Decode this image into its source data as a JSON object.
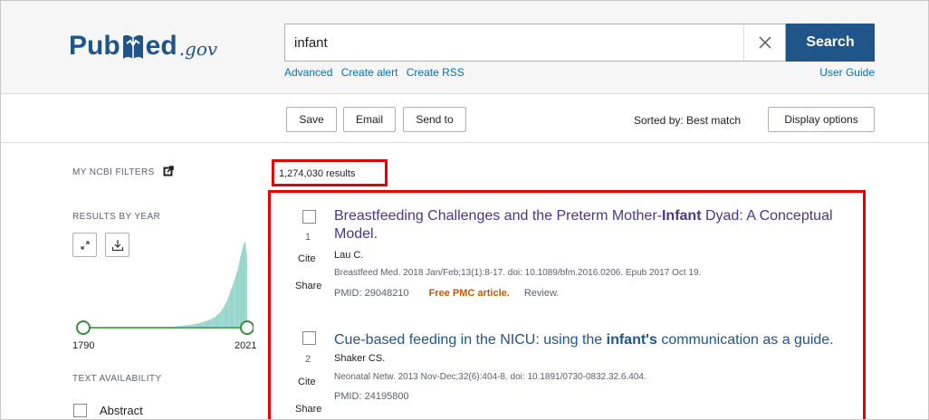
{
  "header": {
    "logo_pub": "Pub",
    "logo_med": "ed",
    "logo_gov": ".gov",
    "search_value": "infant",
    "search_button": "Search",
    "links": [
      "Advanced",
      "Create alert",
      "Create RSS"
    ],
    "user_guide": "User Guide"
  },
  "toolbar": {
    "save": "Save",
    "email": "Email",
    "send_to": "Send to",
    "sorted_by": "Sorted by: Best match",
    "display_options": "Display options"
  },
  "sidebar": {
    "my_ncbi_filters": "MY NCBI FILTERS",
    "results_by_year": "RESULTS BY YEAR",
    "year_start": "1790",
    "year_end": "2021",
    "text_availability": "TEXT AVAILABILITY",
    "abstract_label": "Abstract",
    "histogram_color": "#9fd9d1",
    "slider_color": "#3a8a3a"
  },
  "results": {
    "count": "1,274,030 results",
    "items": [
      {
        "num": "1",
        "title_before": "Breastfeeding Challenges and the Preterm Mother-",
        "title_highlight": "Infant",
        "title_after": " Dyad: A Conceptual Model.",
        "author": "Lau C.",
        "citation": "Breastfeed Med. 2018 Jan/Feb;13(1):8-17. doi: 10.1089/bfm.2016.0206. Epub 2017 Oct 19.",
        "pmid": "PMID: 29048210",
        "free_pmc": "Free PMC article.",
        "review": "Review.",
        "cite": "Cite",
        "share": "Share"
      },
      {
        "num": "2",
        "title_before": "Cue-based feeding in the NICU: using the ",
        "title_highlight": "infant's",
        "title_after": " communication as a guide.",
        "author": "Shaker CS.",
        "citation": "Neonatal Netw. 2013 Nov-Dec;32(6):404-8. doi: 10.1891/0730-0832.32.6.404.",
        "pmid": "PMID: 24195800",
        "cite": "Cite",
        "share": "Share"
      }
    ]
  },
  "colors": {
    "brand_blue": "#20558a",
    "link_blue": "#0071bc",
    "highlight_red": "#e60000",
    "visited_purple": "#4b368b"
  }
}
